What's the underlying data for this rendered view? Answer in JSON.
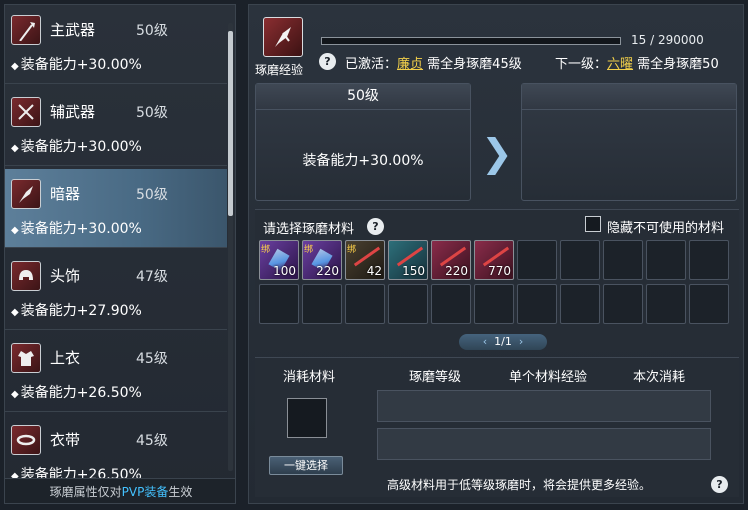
{
  "sidebar": {
    "items": [
      {
        "name": "主武器",
        "level": "50级",
        "bonus": "装备能力+30.00%",
        "icon": "spear-icon"
      },
      {
        "name": "辅武器",
        "level": "50级",
        "bonus": "装备能力+30.00%",
        "icon": "crossed-blades-icon"
      },
      {
        "name": "暗器",
        "level": "50级",
        "bonus": "装备能力+30.00%",
        "icon": "dart-icon",
        "active": true
      },
      {
        "name": "头饰",
        "level": "47级",
        "bonus": "装备能力+27.90%",
        "icon": "helmet-icon"
      },
      {
        "name": "上衣",
        "level": "45级",
        "bonus": "装备能力+26.50%",
        "icon": "robe-icon"
      },
      {
        "name": "衣带",
        "level": "45级",
        "bonus": "装备能力+26.50%",
        "icon": "belt-icon"
      }
    ],
    "footer_prefix": "琢磨属性仅对",
    "footer_highlight": "PVP装备",
    "footer_suffix": "生效"
  },
  "exp": {
    "label": "琢磨经验",
    "value": "15 / 290000",
    "fill": 5e-05,
    "active_prefix": "已激活：",
    "active_name": "廉贞",
    "active_suffix": "需全身琢磨45级",
    "next_prefix": "下一级：",
    "next_name": "六曜",
    "next_suffix": "需全身琢磨50"
  },
  "current_card": {
    "title": "50级",
    "bonus": "装备能力+30.00%"
  },
  "next_card": {
    "title": "",
    "bonus": ""
  },
  "materials": {
    "title": "请选择琢磨材料",
    "hide_label": "隐藏不可使用的材料",
    "hide_checked": false,
    "items": [
      {
        "count": "100",
        "tag": "绑",
        "tone": "purple",
        "icon": "crystal-icon"
      },
      {
        "count": "220",
        "tag": "绑",
        "tone": "purple",
        "icon": "crystal-icon"
      },
      {
        "count": "42",
        "tag": "绑",
        "tone": "dark",
        "icon": "blade-shard-icon"
      },
      {
        "count": "150",
        "tag": "",
        "tone": "teal",
        "icon": "blade-shard-icon"
      },
      {
        "count": "220",
        "tag": "",
        "tone": "red",
        "icon": "blade-shard-icon"
      },
      {
        "count": "770",
        "tag": "",
        "tone": "red",
        "icon": "blade-shard-icon"
      }
    ],
    "page": "1/1"
  },
  "cost": {
    "col_material": "消耗材料",
    "col_level": "琢磨等级",
    "col_exp": "单个材料经验",
    "col_consume": "本次消耗",
    "onekey_label": "一键选择",
    "note": "高级材料用于低等级琢磨时，将会提供更多经验。"
  },
  "help_label": "?"
}
